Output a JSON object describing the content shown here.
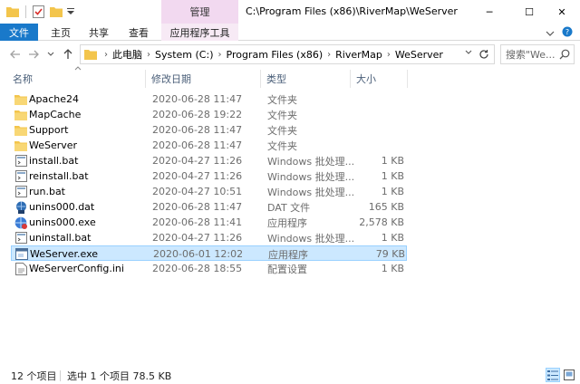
{
  "window": {
    "title": "C:\\Program Files (x86)\\RiverMap\\WeServer",
    "context_tab": "管理",
    "minimize": "─",
    "maximize": "☐",
    "close": "✕"
  },
  "ribbon": {
    "tabs": [
      "文件",
      "主页",
      "共享",
      "查看",
      "应用程序工具"
    ]
  },
  "address": {
    "crumbs": [
      "此电脑",
      "System (C:)",
      "Program Files (x86)",
      "RiverMap",
      "WeServer"
    ],
    "search_placeholder": "搜索\"We..."
  },
  "columns": {
    "name": "名称",
    "date": "修改日期",
    "type": "类型",
    "size": "大小"
  },
  "files": [
    {
      "icon": "folder-icon",
      "name": "Apache24",
      "date": "2020-06-28 11:47",
      "type": "文件夹",
      "size": ""
    },
    {
      "icon": "folder-icon",
      "name": "MapCache",
      "date": "2020-06-28 19:22",
      "type": "文件夹",
      "size": ""
    },
    {
      "icon": "folder-icon",
      "name": "Support",
      "date": "2020-06-28 11:47",
      "type": "文件夹",
      "size": ""
    },
    {
      "icon": "folder-icon",
      "name": "WeServer",
      "date": "2020-06-28 11:47",
      "type": "文件夹",
      "size": ""
    },
    {
      "icon": "batch-file-icon",
      "name": "install.bat",
      "date": "2020-04-27 11:26",
      "type": "Windows 批处理...",
      "size": "1 KB"
    },
    {
      "icon": "batch-file-icon",
      "name": "reinstall.bat",
      "date": "2020-04-27 11:26",
      "type": "Windows 批处理...",
      "size": "1 KB"
    },
    {
      "icon": "batch-file-icon",
      "name": "run.bat",
      "date": "2020-04-27 10:51",
      "type": "Windows 批处理...",
      "size": "1 KB"
    },
    {
      "icon": "dat-file-icon",
      "name": "unins000.dat",
      "date": "2020-06-28 11:47",
      "type": "DAT 文件",
      "size": "165 KB"
    },
    {
      "icon": "uninstaller-icon",
      "name": "unins000.exe",
      "date": "2020-06-28 11:41",
      "type": "应用程序",
      "size": "2,578 KB"
    },
    {
      "icon": "batch-file-icon",
      "name": "uninstall.bat",
      "date": "2020-04-27 11:26",
      "type": "Windows 批处理...",
      "size": "1 KB"
    },
    {
      "icon": "application-icon",
      "name": "WeServer.exe",
      "date": "2020-06-01 12:02",
      "type": "应用程序",
      "size": "79 KB",
      "selected": true
    },
    {
      "icon": "config-file-icon",
      "name": "WeServerConfig.ini",
      "date": "2020-06-28 18:55",
      "type": "配置设置",
      "size": "1 KB"
    }
  ],
  "status": {
    "item_count": "12 个项目",
    "selection": "选中 1 个项目  78.5 KB"
  },
  "colors": {
    "accent": "#1979ca",
    "manage_tab": "#f2d9f0",
    "selection_bg": "#cce8ff",
    "selection_border": "#99d1ff",
    "folder": "#f3c54c"
  }
}
